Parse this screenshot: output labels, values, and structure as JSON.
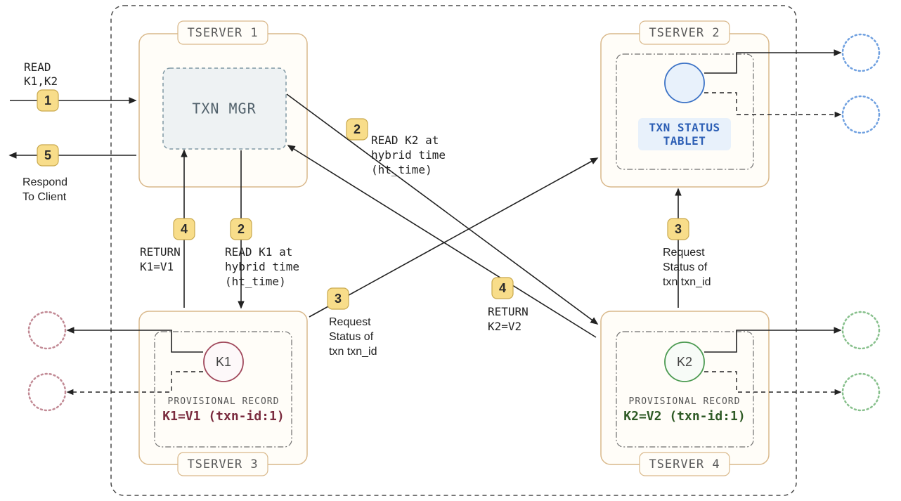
{
  "boundary": {},
  "servers": {
    "s1": {
      "title": "TSERVER 1",
      "txnmgr": "TXN MGR"
    },
    "s2": {
      "title": "TSERVER 2",
      "txn_status_l1": "TXN STATUS",
      "txn_status_l2": "TABLET"
    },
    "s3": {
      "title": "TSERVER 3",
      "key": "K1",
      "prov_label": "PROVISIONAL RECORD",
      "prov_value": "K1=V1 (txn-id:1)"
    },
    "s4": {
      "title": "TSERVER 4",
      "key": "K2",
      "prov_label": "PROVISIONAL RECORD",
      "prov_value": "K2=V2 (txn-id:1)"
    }
  },
  "steps": {
    "s1": {
      "num": "1",
      "l1": "READ",
      "l2": "K1,K2"
    },
    "s2a": {
      "num": "2",
      "l1": "READ K1 at",
      "l2": "hybrid time",
      "l3": "(ht_time)"
    },
    "s2b": {
      "num": "2",
      "l1": "READ K2 at",
      "l2": "hybrid time",
      "l3": "(ht_time)"
    },
    "s3a": {
      "num": "3",
      "l1": "Request",
      "l2": "Status of",
      "l3": "txn txn_id"
    },
    "s3b": {
      "num": "3",
      "l1": "Request",
      "l2": "Status of",
      "l3": "txn txn_id"
    },
    "s4a": {
      "num": "4",
      "l1": "RETURN",
      "l2": "K1=V1"
    },
    "s4b": {
      "num": "4",
      "l1": "RETURN",
      "l2": "K2=V2"
    },
    "s5": {
      "num": "5",
      "l1": "Respond",
      "l2": "To Client"
    }
  }
}
